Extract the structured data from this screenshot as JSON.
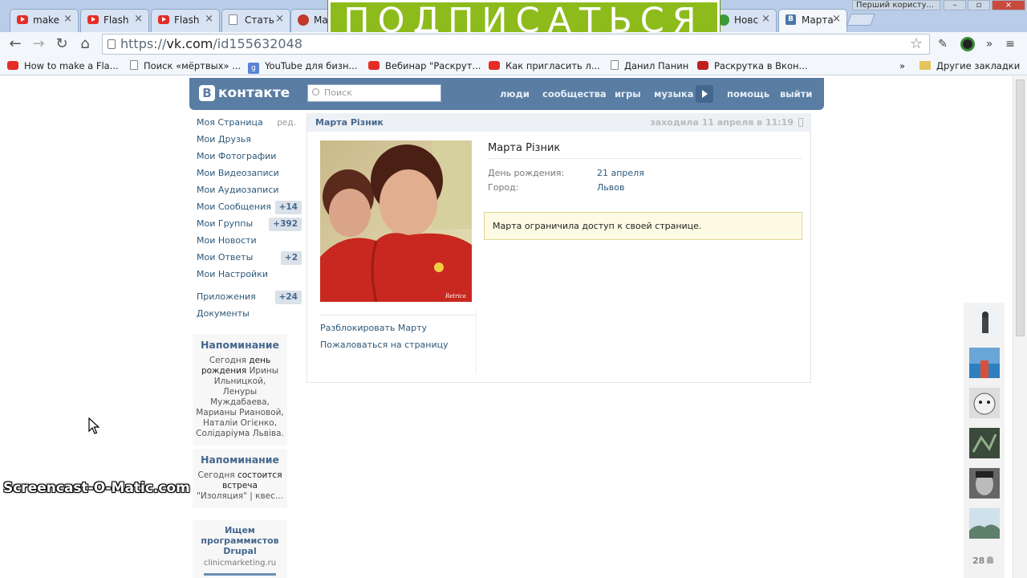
{
  "browser": {
    "tabs": [
      {
        "label": "make",
        "icon": "youtube-icon"
      },
      {
        "label": "Flash",
        "icon": "youtube-icon"
      },
      {
        "label": "Flash",
        "icon": "youtube-icon"
      },
      {
        "label": "Стать",
        "icon": "page-icon"
      },
      {
        "label": "Ма",
        "icon": "chrome-page-icon"
      },
      {
        "label": "Новс",
        "icon": "green-circle-icon"
      },
      {
        "label": "Марта",
        "icon": "vk-icon"
      }
    ],
    "user_chip": "Перший користу...",
    "url_scheme": "https://",
    "url_host": "vk.com",
    "url_path": "/id155632048",
    "bookmarks": [
      "How to make a Fla...",
      "Поиск «мёртвых» ...",
      "YouTube для бизн...",
      "Вебинар \"Раскрут...",
      "Как пригласить л...",
      "Данил Панин",
      "Раскрутка в Вкон...",
      "»",
      "Другие закладки"
    ]
  },
  "overlay": {
    "subscribe_banner": "ПОДПИСАТЬСЯ",
    "watermark": "Screencast-O-Matic.com"
  },
  "vk": {
    "logo": "контакте",
    "logo_letter": "В",
    "search_placeholder": "Поиск",
    "nav": [
      "люди",
      "сообщества",
      "игры",
      "музыка",
      "помощь",
      "выйти"
    ],
    "menu": [
      {
        "label": "Моя Страница",
        "extra": "ред."
      },
      {
        "label": "Мои Друзья"
      },
      {
        "label": "Мои Фотографии"
      },
      {
        "label": "Мои Видеозаписи"
      },
      {
        "label": "Мои Аудиозаписи"
      },
      {
        "label": "Мои Сообщения",
        "count": "+14"
      },
      {
        "label": "Мои Группы",
        "count": "+392"
      },
      {
        "label": "Мои Новости"
      },
      {
        "label": "Мои Ответы",
        "count": "+2"
      },
      {
        "label": "Мои Настройки"
      },
      {
        "label": "Приложения",
        "count": "+24"
      },
      {
        "label": "Документы"
      }
    ],
    "reminder1": {
      "title": "Напоминание",
      "prefix": "Сегодня",
      "bold": "день рождения",
      "names": "Ирины Ильницкой, Ленуры Муждабаева, Марианы Риановой, Наталіи Огієнко, Солідаріума Львіва."
    },
    "reminder2": {
      "title": "Напоминание",
      "prefix": "Сегодня",
      "bold": "состоится встреча",
      "text": "\"Изоляция\" | квес..."
    },
    "ad": {
      "title": "Ищем программистов Drupal",
      "url": "clinicmarketing.ru"
    },
    "profile": {
      "header_name": "Марта Різник",
      "last_seen": "заходила 11 апреля в 11:19",
      "name": "Марта Різник",
      "birthday_label": "День рождения:",
      "birthday_value": "21 апреля",
      "city_label": "Город:",
      "city_value": "Львов",
      "notice": "Марта ограничила доступ к своей странице.",
      "actions": [
        "Разблокировать Марту",
        "Пожаловаться на страницу"
      ],
      "photo_signature": "Retrica"
    },
    "friends_count": "28"
  },
  "colors": {
    "vk_header": "#597da3",
    "vk_link": "#2b587a",
    "subscribe_green": "#8dbb1c",
    "notice_bg": "#fefbe4"
  }
}
